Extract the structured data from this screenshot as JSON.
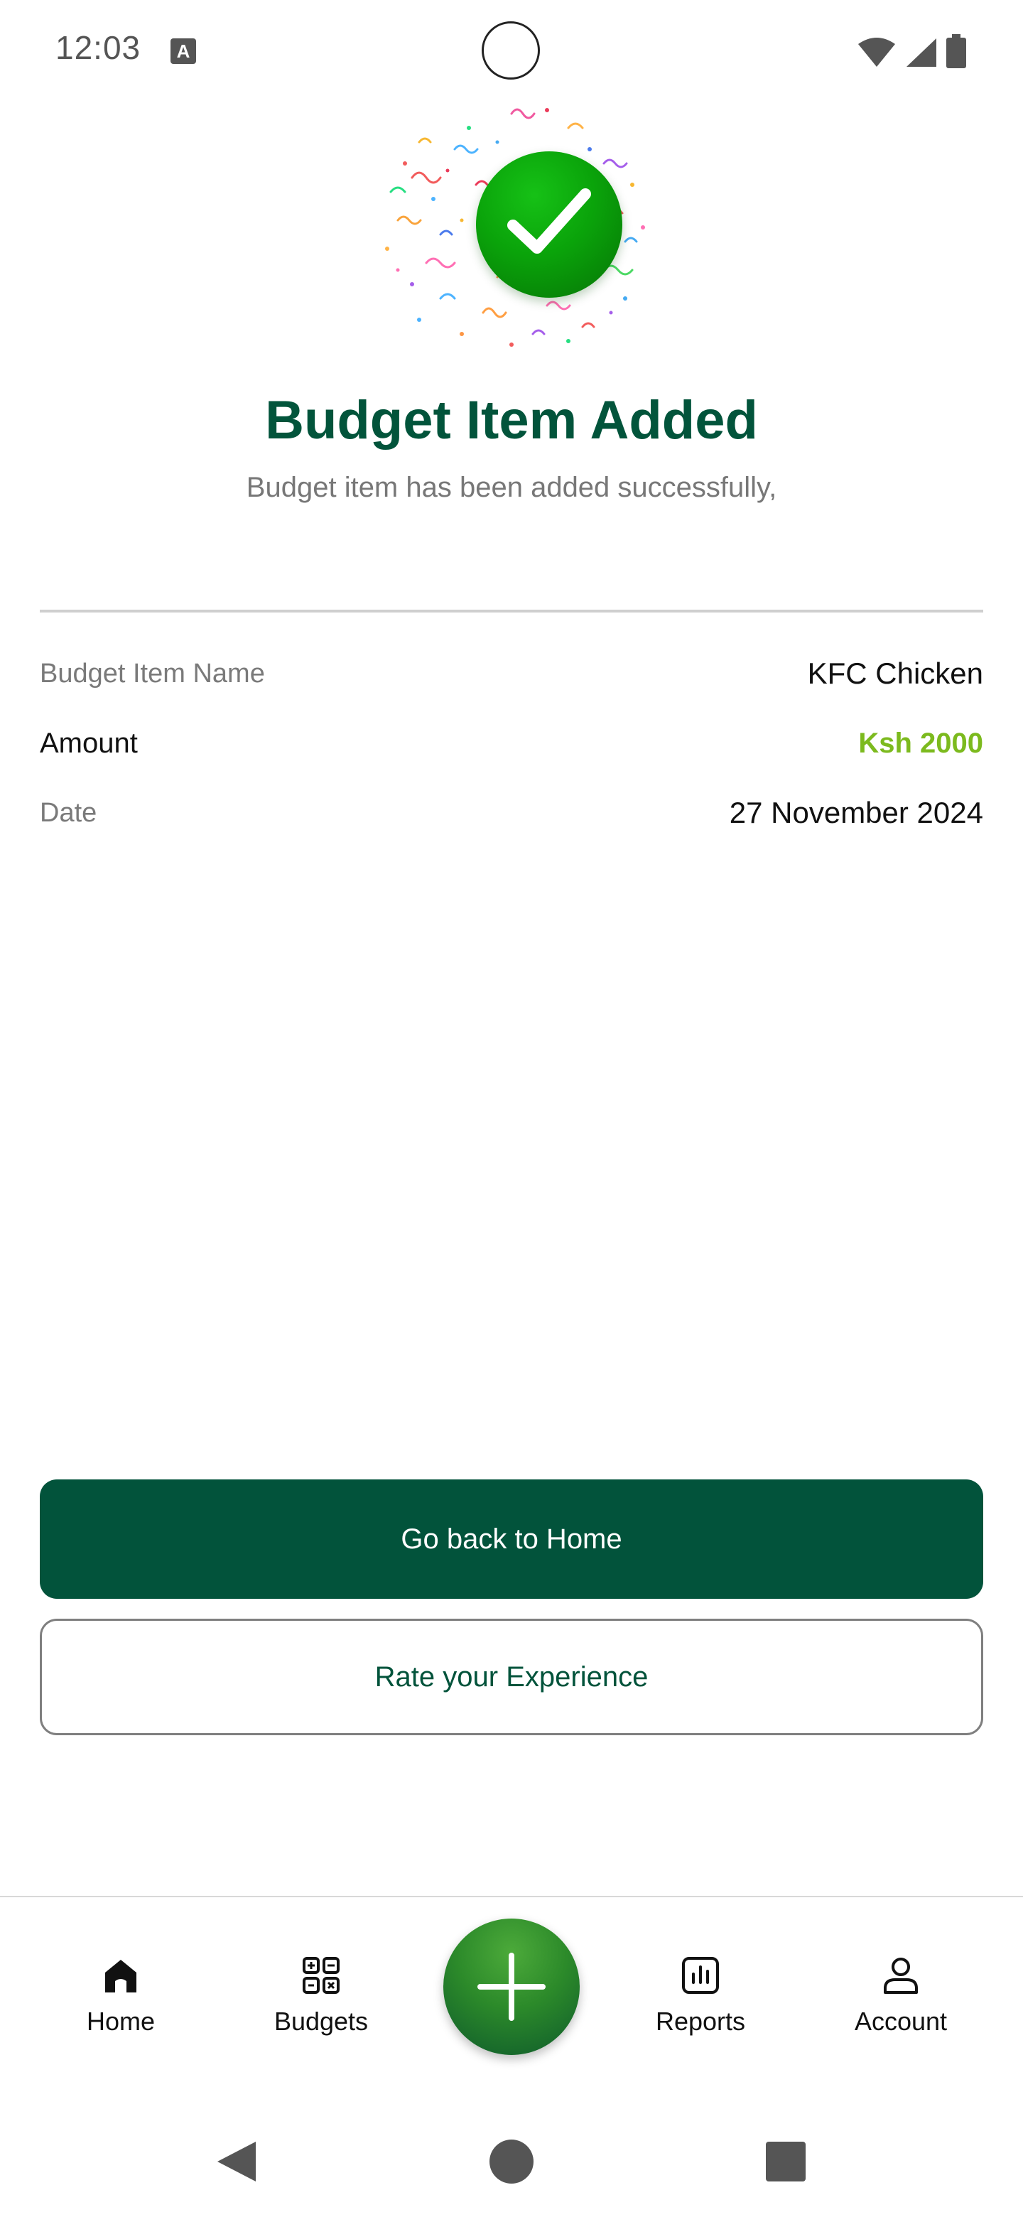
{
  "status_bar": {
    "time": "12:03",
    "notification_icon": "a-keyboard-icon",
    "icons": [
      "wifi-icon",
      "signal-icon",
      "battery-icon"
    ]
  },
  "success": {
    "icon": "check-circle-icon",
    "title": "Budget Item Added",
    "subtitle": "Budget item has been added successfully,"
  },
  "details": {
    "name_label": "Budget Item Name",
    "name_value": "KFC Chicken",
    "amount_label": "Amount",
    "amount_value": "Ksh 2000",
    "date_label": "Date",
    "date_value": "27 November 2024"
  },
  "actions": {
    "primary_label": "Go back to Home",
    "secondary_label": "Rate your Experience"
  },
  "bottom_nav": {
    "items": [
      {
        "label": "Home",
        "icon": "home-icon"
      },
      {
        "label": "Budgets",
        "icon": "budgets-icon"
      },
      {
        "label": "Reports",
        "icon": "reports-icon"
      },
      {
        "label": "Account",
        "icon": "account-icon"
      }
    ],
    "fab_icon": "plus-icon"
  },
  "system_nav": [
    "back-icon",
    "home-circle-icon",
    "recents-icon"
  ],
  "colors": {
    "brand_dark_green": "#02533b",
    "success_green": "#0aa30a",
    "amount_green": "#7cba1e"
  }
}
